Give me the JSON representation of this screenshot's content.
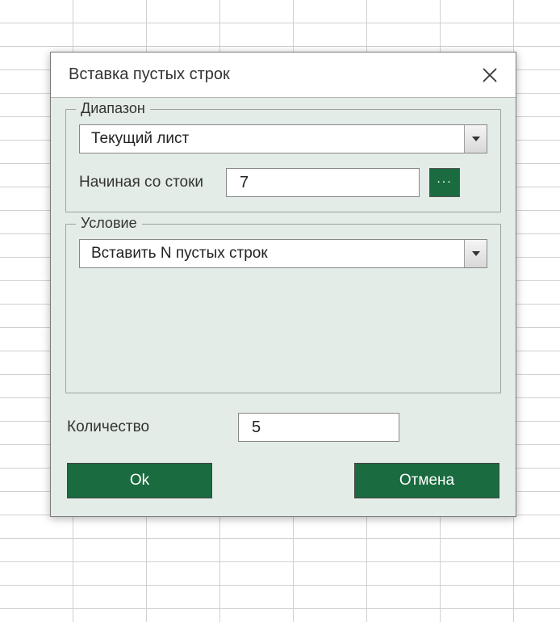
{
  "dialog": {
    "title": "Вставка пустых строк",
    "close_label": "Закрыть"
  },
  "range": {
    "legend": "Диапазон",
    "scope_value": "Текущий лист",
    "start_row_label": "Начиная со стоки",
    "start_row_value": "7",
    "picker_label": "..."
  },
  "condition": {
    "legend": "Условие",
    "mode_value": "Вставить N пустых строк"
  },
  "quantity": {
    "label": "Количество",
    "value": "5"
  },
  "buttons": {
    "ok": "Ok",
    "cancel": "Отмена"
  }
}
